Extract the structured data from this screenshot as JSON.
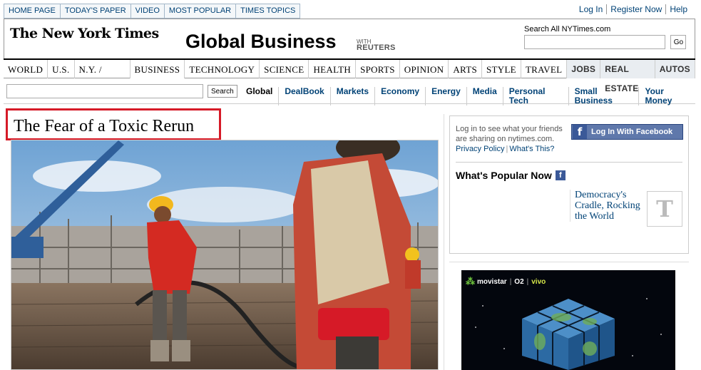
{
  "topnav": [
    "HOME PAGE",
    "TODAY'S PAPER",
    "VIDEO",
    "MOST POPULAR",
    "TIMES TOPICS"
  ],
  "account": {
    "login": "Log In",
    "register": "Register Now",
    "help": "Help"
  },
  "masthead": {
    "logo": "The New York Times",
    "section": "Global Business",
    "partner_with": "WITH",
    "partner": "REUTERS",
    "search_label": "Search All NYTimes.com",
    "search_go": "Go"
  },
  "sections": [
    "WORLD",
    "U.S.",
    "N.Y. / REGION",
    "BUSINESS",
    "TECHNOLOGY",
    "SCIENCE",
    "HEALTH",
    "SPORTS",
    "OPINION",
    "ARTS",
    "STYLE",
    "TRAVEL",
    "JOBS",
    "REAL ESTATE",
    "AUTOS"
  ],
  "subnav": {
    "search_button": "Search",
    "links": [
      "Global",
      "DealBook",
      "Markets",
      "Economy",
      "Energy",
      "Media",
      "Personal Tech",
      "Small Business",
      "Your Money"
    ]
  },
  "article": {
    "headline": "The Fear of a Toxic Rerun"
  },
  "social": {
    "message": "Log in to see what your friends are sharing on nytimes.com.",
    "privacy": "Privacy Policy",
    "whats_this": "What's This?",
    "fb_button": "Log In With Facebook",
    "popular_title": "What's Popular Now",
    "popular_item": "Democracy's Cradle, Rocking the World"
  },
  "ad": {
    "brand1": "movistar",
    "brand2": "O2",
    "brand3": "vivo"
  },
  "colors": {
    "link": "#004276",
    "highlight": "#d61a27",
    "facebook": "#3b5998"
  }
}
